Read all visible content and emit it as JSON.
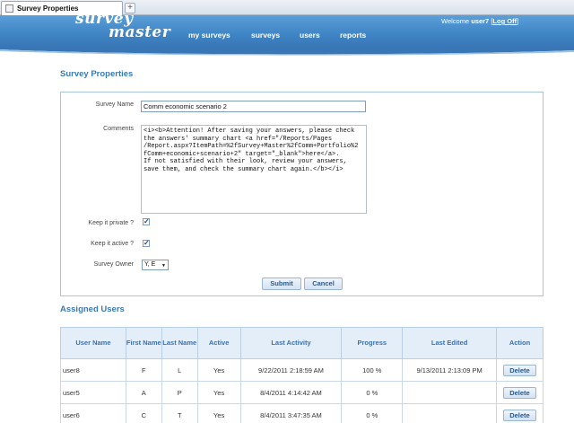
{
  "browser": {
    "tab_title": "Survey Properties",
    "new_tab_symbol": "+"
  },
  "header": {
    "logo_line1": "survey",
    "logo_line2": "master",
    "nav": [
      "my surveys",
      "surveys",
      "users",
      "reports"
    ],
    "welcome_prefix": "Welcome",
    "username": "user7",
    "logoff_open": "[",
    "logoff_label": "Log Off",
    "logoff_close": "]"
  },
  "properties": {
    "title": "Survey Properties",
    "survey_name_label": "Survey Name",
    "survey_name_value": "Comm economic scenario 2",
    "comments_label": "Comments",
    "comments_value": "<i><b>Attention! After saving your answers, please check\nthe answers' summary chart <a href=\"/Reports/Pages\n/Report.aspx?ItemPath=%2fSurvey+Master%2fComm+Portfolio%2\nfComm+economic+scenario+2\" target=\"_blank\">here</a>.\nIf not satisfied with their look, review your answers,\nsave them, and check the summary chart again.</b></i>",
    "private_label": "Keep it private ?",
    "private_checked": true,
    "active_label": "Keep it active ?",
    "active_checked": true,
    "owner_label": "Survey Owner",
    "owner_value": "Y, E",
    "submit_label": "Submit",
    "cancel_label": "Cancel",
    "check_mark": "✓"
  },
  "assigned_users": {
    "title": "Assigned Users",
    "columns": [
      "User Name",
      "First Name",
      "Last Name",
      "Active",
      "Last Activity",
      "Progress",
      "Last Edited",
      "Action"
    ],
    "rows": [
      {
        "user": "user8",
        "first": "F",
        "last": "L",
        "active": "Yes",
        "last_activity": "9/22/2011 2:18:59 AM",
        "progress": "100 %",
        "last_edited": "9/13/2011 2:13:09 PM",
        "action": "Delete"
      },
      {
        "user": "user5",
        "first": "A",
        "last": "P",
        "active": "Yes",
        "last_activity": "8/4/2011 4:14:42 AM",
        "progress": "0 %",
        "last_edited": "",
        "action": "Delete"
      },
      {
        "user": "user6",
        "first": "C",
        "last": "T",
        "active": "Yes",
        "last_activity": "8/4/2011 3:47:35 AM",
        "progress": "0 %",
        "last_edited": "",
        "action": "Delete"
      }
    ]
  },
  "colors": {
    "header_blue": "#3f84c4",
    "title_blue": "#3a7ab8",
    "panel_border": "#a9c6e0",
    "table_header_bg": "#e3eef8"
  }
}
